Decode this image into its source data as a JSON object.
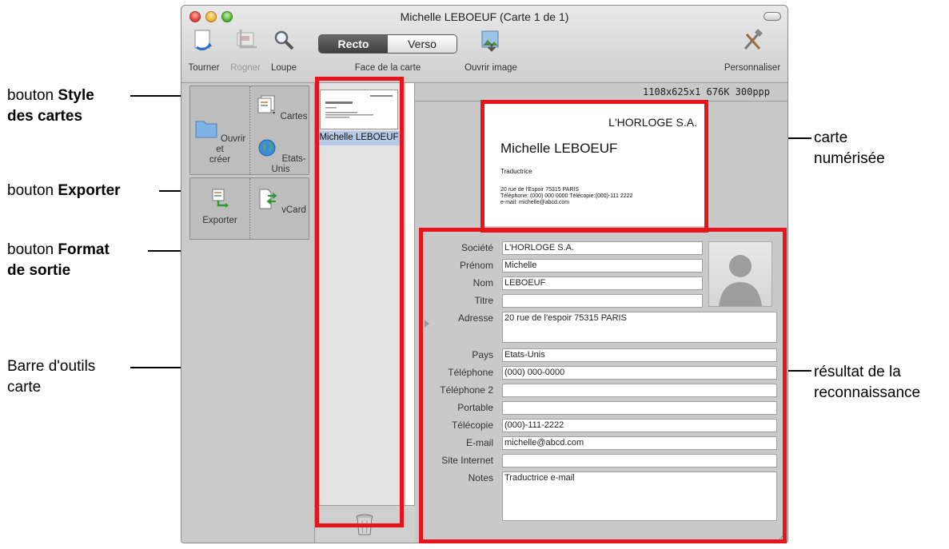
{
  "window": {
    "title": "Michelle LEBOEUF (Carte 1 de 1)"
  },
  "toolbar": {
    "rotate_label": "Tourner",
    "crop_label": "Rogner",
    "zoom_label": "Loupe",
    "segment": {
      "front": "Recto",
      "back": "Verso",
      "label": "Face de la carte"
    },
    "open_image_label": "Ouvrir image",
    "customize_label": "Personnaliser"
  },
  "card_toolbar": {
    "open_create_line1": "Ouvrir et",
    "open_create_line2": "créer",
    "cards_label": "Cartes",
    "region_label": "Etats-Unis",
    "export_label": "Exporter",
    "vcard_label": "vCard"
  },
  "thumbnail": {
    "label": "Michelle LEBOEUF"
  },
  "image_info": "1108x625x1  676K  300ppp",
  "business_card": {
    "company": "L'HORLOGE S.A.",
    "name": "Michelle LEBOEUF",
    "role": "Traductrice",
    "address_line": "20 rue de l'Espoir 75315 PARIS",
    "phone_line": "Téléphone: (000) 000 0000    Télécopie:(000)-111 2222",
    "email_line": "e-mail: michelle@abcd.com"
  },
  "form": {
    "fields": [
      {
        "label": "Société",
        "value": "L'HORLOGE S.A."
      },
      {
        "label": "Prénom",
        "value": "Michelle"
      },
      {
        "label": "Nom",
        "value": "LEBOEUF"
      },
      {
        "label": "Titre",
        "value": ""
      },
      {
        "label": "Adresse",
        "value": "20 rue de l'espoir 75315 PARIS"
      },
      {
        "label": "Pays",
        "value": "Etats-Unis"
      },
      {
        "label": "Téléphone",
        "value": "(000) 000-0000"
      },
      {
        "label": "Téléphone 2",
        "value": ""
      },
      {
        "label": "Portable",
        "value": ""
      },
      {
        "label": "Télécopie",
        "value": "(000)-111-2222"
      },
      {
        "label": "E-mail",
        "value": "michelle@abcd.com"
      },
      {
        "label": "Site Internet",
        "value": ""
      },
      {
        "label": "Notes",
        "value": "Traductrice e-mail"
      }
    ]
  },
  "annotations": {
    "style_prefix": "bouton ",
    "style_bold1": "Style",
    "style_bold2": "des cartes",
    "export_prefix": "bouton ",
    "export_bold": "Exporter",
    "format_prefix": "bouton ",
    "format_bold1": "Format",
    "format_bold2": "de sortie",
    "toolbar_line1": "Barre d'outils",
    "toolbar_line2": "carte",
    "scanned_line1": "carte",
    "scanned_line2": "numérisée",
    "result_line1": "résultat de la",
    "result_line2": "reconnaissance"
  },
  "colors": {
    "highlight": "#e8141b",
    "selection": "#b6c9e6"
  }
}
